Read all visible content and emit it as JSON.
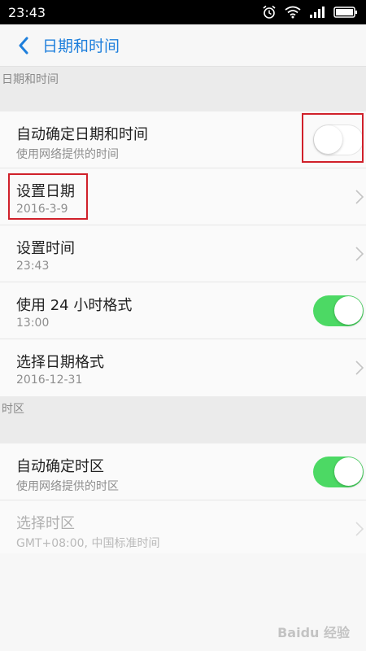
{
  "status_bar": {
    "time": "23:43"
  },
  "header": {
    "title": "日期和时间"
  },
  "section_date": {
    "label": "日期和时间"
  },
  "date_rows": [
    {
      "title": "自动确定日期和时间",
      "subtitle": "使用网络提供的时间",
      "control": "toggle",
      "on": false
    },
    {
      "title": "设置日期",
      "subtitle": "2016-3-9",
      "control": "chevron"
    },
    {
      "title": "设置时间",
      "subtitle": "23:43",
      "control": "chevron"
    },
    {
      "title": "使用 24 小时格式",
      "subtitle": "13:00",
      "control": "toggle",
      "on": true
    },
    {
      "title": "选择日期格式",
      "subtitle": "2016-12-31",
      "control": "chevron"
    }
  ],
  "section_timezone": {
    "label": "时区"
  },
  "timezone_rows": [
    {
      "title": "自动确定时区",
      "subtitle": "使用网络提供的时区",
      "control": "toggle",
      "on": true
    },
    {
      "title": "选择时区",
      "subtitle": "GMT+08:00, 中国标准时间",
      "control": "chevron",
      "disabled": true
    }
  ],
  "watermark": "Baidu 经验",
  "colors": {
    "accent": "#1e7fdc",
    "toggle_on": "#4cd964",
    "annotation": "#d0202a"
  },
  "icons": [
    "alarm-icon",
    "wifi-icon",
    "signal-icon",
    "battery-icon",
    "back-chevron-icon",
    "chevron-right-icon"
  ]
}
